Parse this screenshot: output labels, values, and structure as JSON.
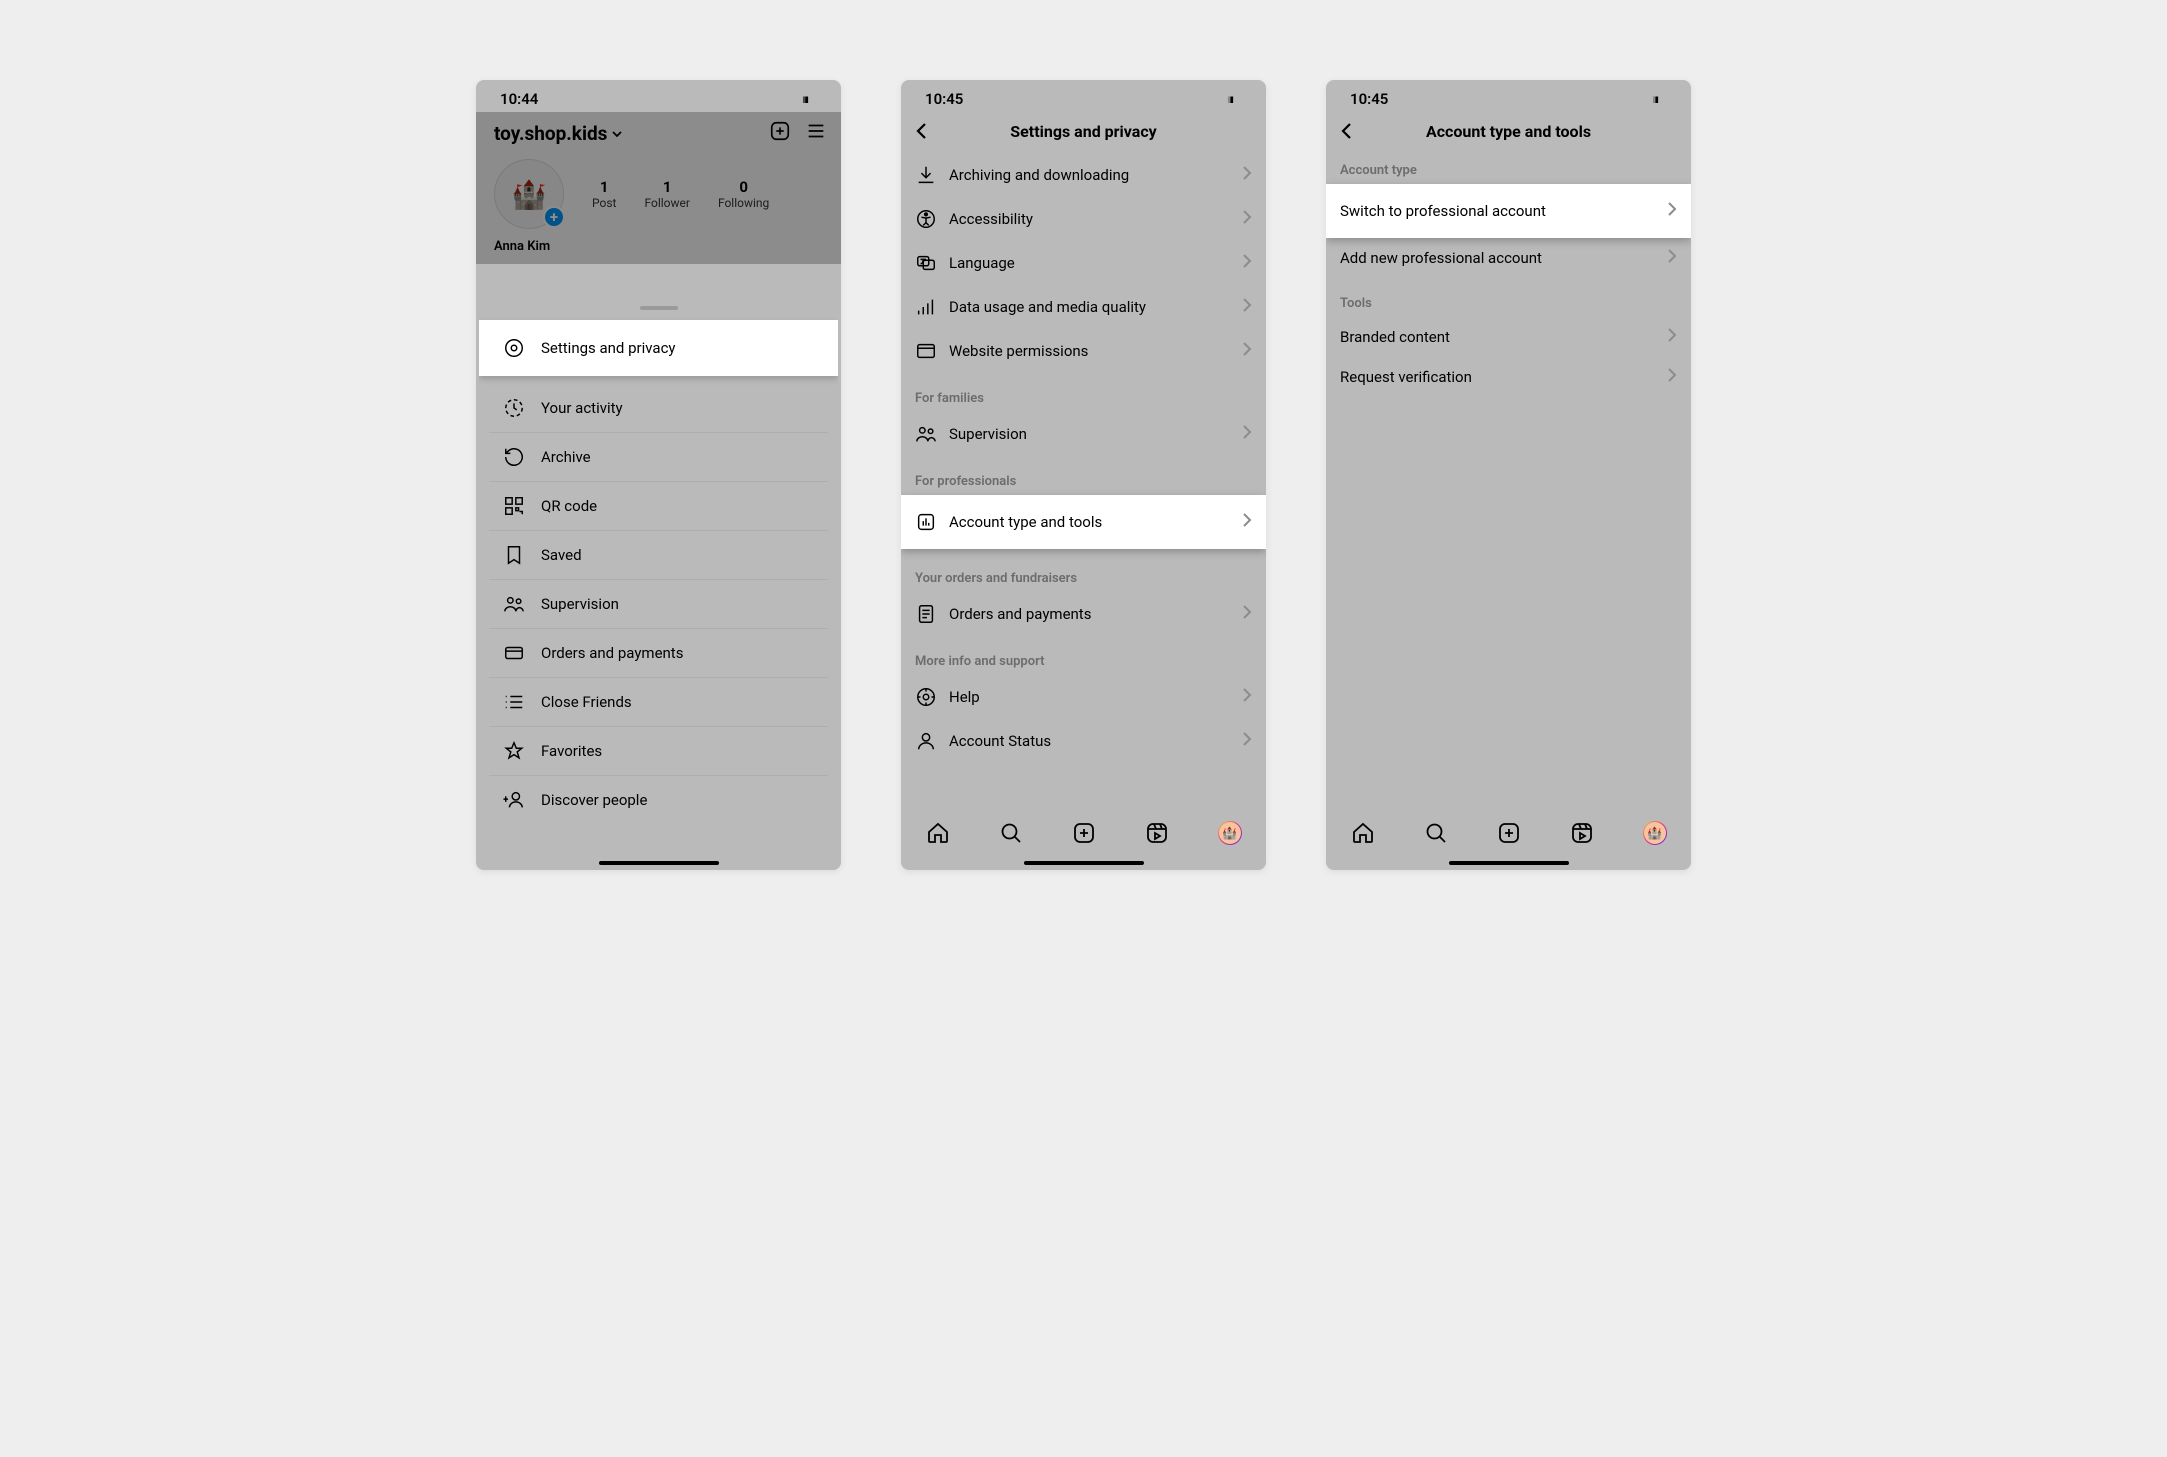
{
  "status": {
    "t1": "10:44",
    "t2": "10:45",
    "t3": "10:45"
  },
  "phone1": {
    "username": "toy.shop.kids",
    "display_name": "Anna Kim",
    "stats": {
      "posts_n": "1",
      "posts_l": "Post",
      "followers_n": "1",
      "followers_l": "Follower",
      "following_n": "0",
      "following_l": "Following"
    },
    "sheet": {
      "settings": "Settings and privacy",
      "activity": "Your activity",
      "archive": "Archive",
      "qr": "QR code",
      "saved": "Saved",
      "supervision": "Supervision",
      "orders": "Orders and payments",
      "close_friends": "Close Friends",
      "favorites": "Favorites",
      "discover": "Discover people"
    }
  },
  "phone2": {
    "title": "Settings and privacy",
    "rows": {
      "archiving": "Archiving and downloading",
      "accessibility": "Accessibility",
      "language": "Language",
      "data": "Data usage and media quality",
      "website": "Website permissions",
      "sec_families": "For families",
      "supervision": "Supervision",
      "sec_pro": "For professionals",
      "acct_type": "Account type and tools",
      "sec_orders": "Your orders and fundraisers",
      "orders": "Orders and payments",
      "sec_support": "More info and support",
      "help": "Help",
      "status": "Account Status"
    }
  },
  "phone3": {
    "title": "Account type and tools",
    "sec_type": "Account type",
    "switch": "Switch to professional account",
    "add": "Add new professional account",
    "sec_tools": "Tools",
    "branded": "Branded content",
    "verify": "Request verification"
  }
}
